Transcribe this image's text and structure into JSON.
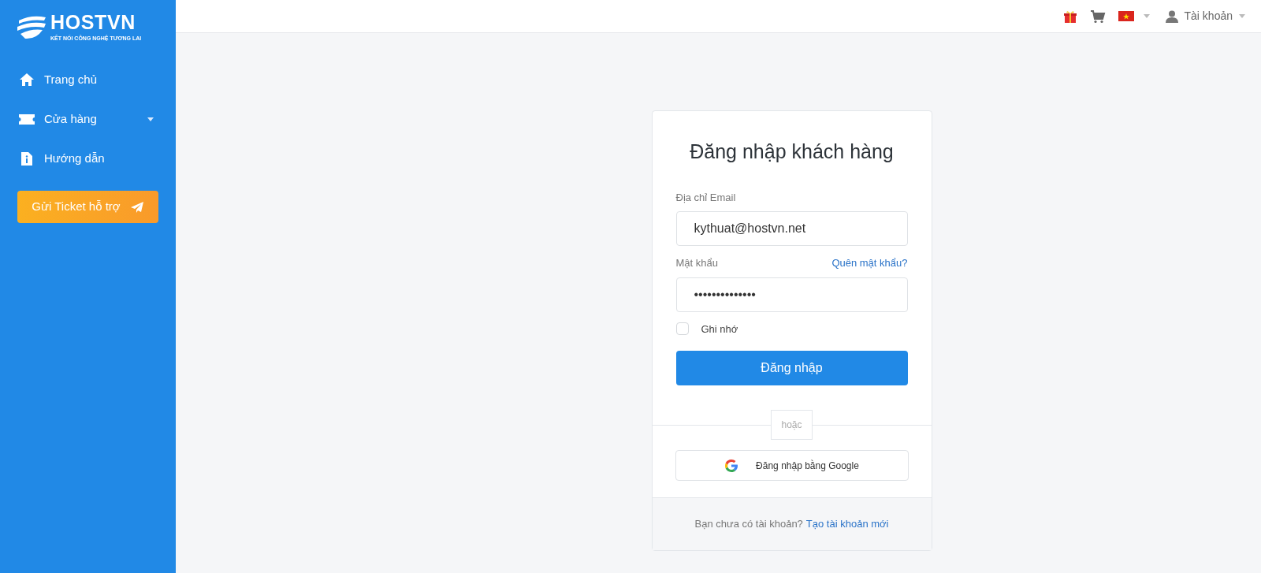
{
  "sidebar": {
    "logo": {
      "name": "HOSTVN",
      "tagline": "KẾT NỐI CÔNG NGHỆ TƯƠNG LAI"
    },
    "items": [
      {
        "kind": "home",
        "label": "Trang chủ",
        "has_submenu": false
      },
      {
        "kind": "store",
        "label": "Cửa hàng",
        "has_submenu": true
      },
      {
        "kind": "guide",
        "label": "Hướng dẫn",
        "has_submenu": false
      }
    ],
    "ticket_button": "Gửi Ticket hỗ trợ"
  },
  "topbar": {
    "account": "Tài khoản"
  },
  "login": {
    "title": "Đăng nhập khách hàng",
    "email": {
      "label": "Địa chỉ Email",
      "value": "kythuat@hostvn.net"
    },
    "password": {
      "label": "Mật khẩu",
      "value": "••••••••••••••",
      "forgot": "Quên mật khẩu?"
    },
    "remember": {
      "label": "Ghi nhớ",
      "checked": false
    },
    "submit": "Đăng nhập",
    "divider": "hoặc",
    "google": "Đăng nhập bằng Google",
    "footer": {
      "text": "Bạn chưa có tài khoản?",
      "link": "Tạo tài khoản mới"
    }
  }
}
